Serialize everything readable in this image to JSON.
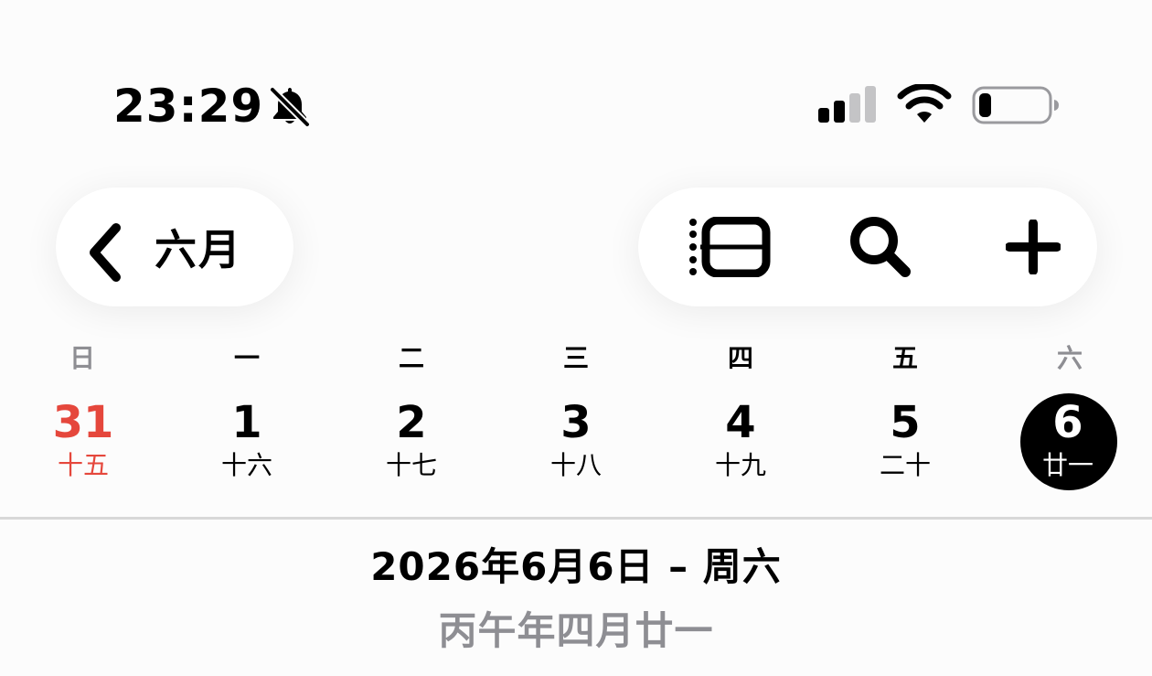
{
  "status_bar": {
    "time": "23:29",
    "silent_icon": "bell-slash-icon",
    "signal_icon": "cellular-signal-icon",
    "wifi_icon": "wifi-icon",
    "battery_icon": "battery-low-icon",
    "signal_bars_active": 2,
    "signal_bars_total": 4
  },
  "nav": {
    "back_icon": "chevron-left-icon",
    "back_label": "六月",
    "tools": [
      {
        "icon": "day-view-icon"
      },
      {
        "icon": "search-icon"
      },
      {
        "icon": "plus-icon"
      }
    ]
  },
  "week": {
    "weekdays": [
      "日",
      "一",
      "二",
      "三",
      "四",
      "五",
      "六"
    ],
    "days": [
      {
        "num": "31",
        "lunar": "十五"
      },
      {
        "num": "1",
        "lunar": "十六"
      },
      {
        "num": "2",
        "lunar": "十七"
      },
      {
        "num": "3",
        "lunar": "十八"
      },
      {
        "num": "4",
        "lunar": "十九"
      },
      {
        "num": "5",
        "lunar": "二十"
      },
      {
        "num": "6",
        "lunar": "廿一"
      }
    ]
  },
  "selected": {
    "full_date": "2026年6月6日 – 周六",
    "lunar_date": "丙午年四月廿一"
  },
  "colors": {
    "today_red": "#e5473c",
    "weekend_gray": "#8e8e93",
    "selected_bg": "#000000"
  }
}
